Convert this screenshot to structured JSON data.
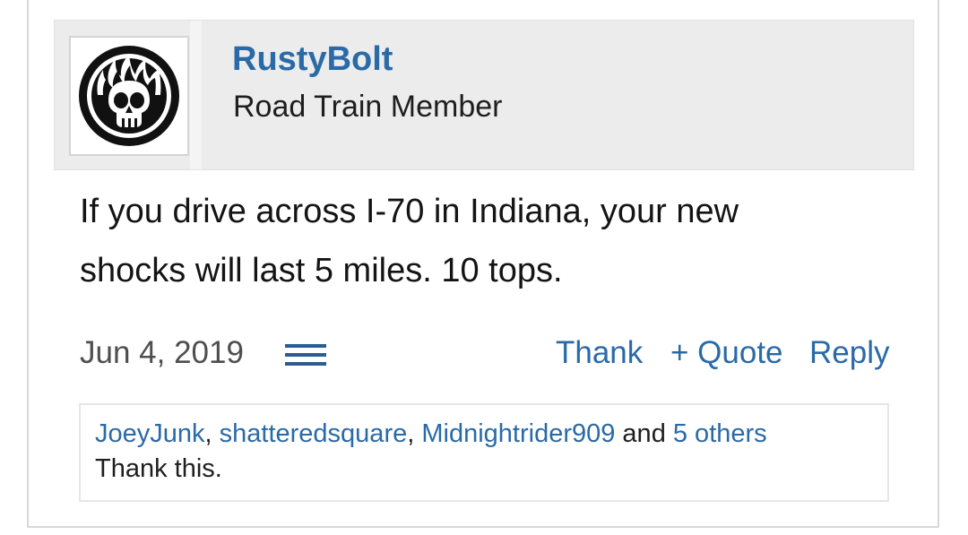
{
  "post": {
    "author": {
      "username": "RustyBolt",
      "title": "Road Train Member",
      "avatar_icon": "flaming-skull-icon"
    },
    "message_line1": "If you drive across I-70 in Indiana, your new",
    "message_line2": "shocks will last 5 miles. 10 tops.",
    "date": "Jun 4, 2019",
    "menu_icon": "hamburger-menu-icon",
    "actions": {
      "thank": "Thank",
      "quote": "+ Quote",
      "reply": "Reply"
    },
    "likes": {
      "users": [
        "JoeyJunk",
        "shatteredsquare",
        "Midnightrider909"
      ],
      "separator": ", ",
      "conjunction": " and ",
      "others": "5 others",
      "suffix": "Thank this."
    }
  },
  "colors": {
    "link": "#2a6aa7",
    "header_bg": "#ececec",
    "text": "#141414",
    "muted": "#4e4e4e"
  }
}
